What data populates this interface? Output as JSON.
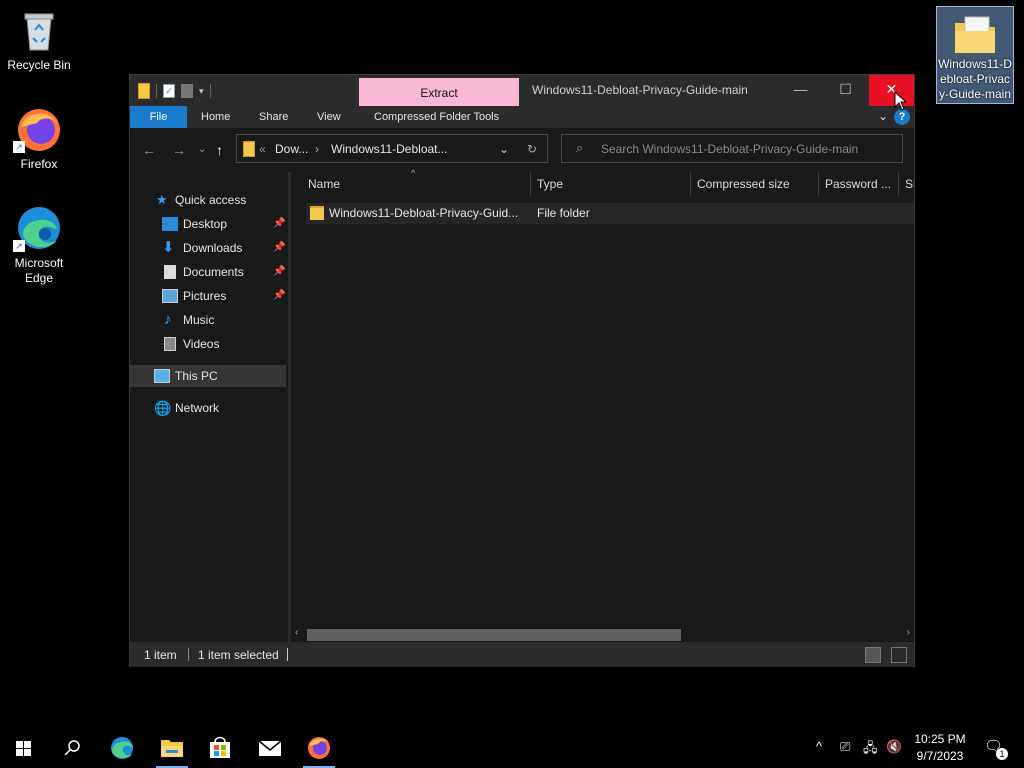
{
  "desktop": {
    "icons": [
      {
        "label": "Recycle Bin"
      },
      {
        "label": "Firefox"
      },
      {
        "label": "Microsoft Edge"
      },
      {
        "label": "Windows11-Debloat-Privacy-Guide-main"
      }
    ]
  },
  "window": {
    "title": "Windows11-Debloat-Privacy-Guide-main",
    "context_tab": "Extract",
    "ribbon_tabs": [
      "File",
      "Home",
      "Share",
      "View",
      "Compressed Folder Tools"
    ],
    "address": {
      "overflow": "«",
      "segments": [
        "Dow...",
        "Windows11-Debloat..."
      ]
    },
    "search_placeholder": "Search Windows11-Debloat-Privacy-Guide-main",
    "nav": {
      "quick_access": "Quick access",
      "items": [
        "Desktop",
        "Downloads",
        "Documents",
        "Pictures",
        "Music",
        "Videos"
      ],
      "this_pc": "This PC",
      "network": "Network"
    },
    "columns": [
      "Name",
      "Type",
      "Compressed size",
      "Password ...",
      "Si"
    ],
    "rows": [
      {
        "name": "Windows11-Debloat-Privacy-Guid...",
        "type": "File folder"
      }
    ],
    "status": {
      "count": "1 item",
      "selected": "1 item selected"
    }
  },
  "taskbar": {
    "time": "10:25 PM",
    "date": "9/7/2023",
    "notifications": "1"
  },
  "colors": {
    "accent": "#1979ca",
    "context_tab": "#f8b7d3",
    "close": "#e81123",
    "folder": "#f3c94b"
  }
}
